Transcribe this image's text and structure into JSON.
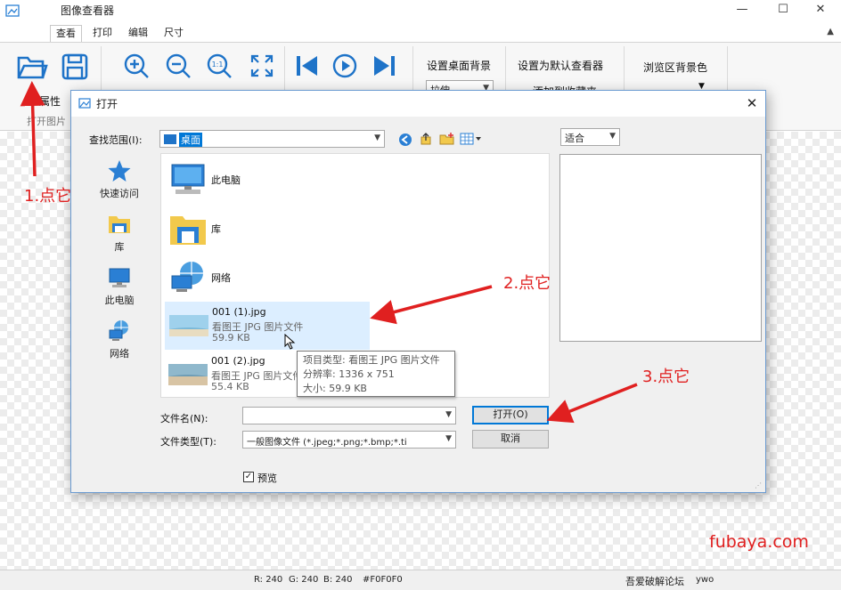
{
  "app": {
    "title": "图像查看器",
    "tabs": [
      "查看",
      "打印",
      "编辑",
      "尺寸"
    ],
    "active_tab": "查看",
    "ribbon": {
      "properties_label": "属性",
      "open_image_label": "打开图片",
      "set_desktop_bg": "设置桌面背景",
      "set_default_viewer": "设置为默认查看器",
      "browse_bg_color": "浏览区背景色",
      "stretch_value": "拉伸",
      "partial_text": "添加到收藏夹"
    },
    "window_controls": {
      "minimize": "—",
      "maximize": "☐",
      "close": "✕"
    },
    "collapse_icon": "▲"
  },
  "dialog": {
    "title": "打开",
    "lookin_label": "查找范围(I):",
    "lookin_value": "桌面",
    "places": [
      {
        "label": "快速访问",
        "icon": "star-icon"
      },
      {
        "label": "库",
        "icon": "library-icon"
      },
      {
        "label": "此电脑",
        "icon": "computer-icon"
      },
      {
        "label": "网络",
        "icon": "network-icon"
      }
    ],
    "files": [
      {
        "name": "此电脑",
        "icon": "computer-icon"
      },
      {
        "name": "库",
        "icon": "library-icon"
      },
      {
        "name": "网络",
        "icon": "network-icon"
      },
      {
        "name": "001 (1).jpg",
        "type": "看图王 JPG 图片文件",
        "size": "59.9 KB",
        "icon": "image-thumbnail",
        "selected": true
      },
      {
        "name": "001 (2).jpg",
        "type": "看图王 JPG 图片文件",
        "size": "55.4 KB",
        "icon": "image-thumbnail"
      }
    ],
    "tooltip": {
      "type": "项目类型: 看图王 JPG 图片文件",
      "resolution": "分辨率: 1336 x 751",
      "size": "大小: 59.9 KB"
    },
    "filename_label": "文件名(N):",
    "filename_value": "",
    "filetype_label": "文件类型(T):",
    "filetype_value": "一般图像文件 (*.jpeg;*.png;*.bmp;*.ti",
    "open_button": "打开(O)",
    "cancel_button": "取消",
    "preview_checkbox": "预览",
    "preview_checked": true,
    "preview_mode": "适合"
  },
  "annotations": {
    "step1": "1.点它",
    "step2": "2.点它",
    "step3": "3.点它",
    "watermark": "fubaya.com",
    "color": "#e02020"
  },
  "statusbar": {
    "r": "R: 240",
    "g": "G: 240",
    "b": "B: 240",
    "hex": "#F0F0F0",
    "forum": "吾爱破解论坛",
    "user": "ywo"
  }
}
